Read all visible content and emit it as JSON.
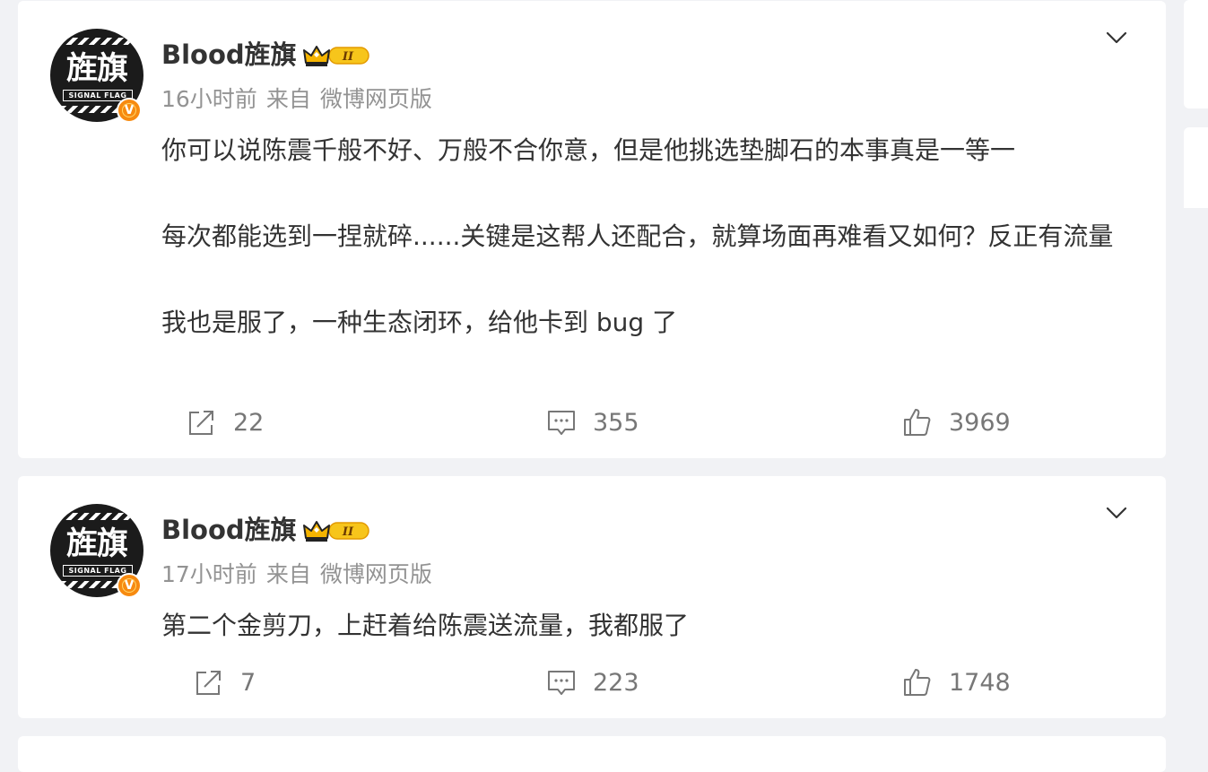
{
  "posts": [
    {
      "author": "Blood旌旗",
      "avatar_text": "旌旗",
      "avatar_subtext": "SIGNAL FLAG",
      "verified_mark": "V",
      "vip_level": "II",
      "time": "16小时前",
      "source_prefix": "来自",
      "source": "微博网页版",
      "paragraphs": [
        "你可以说陈震千般不好、万般不合你意，但是他挑选垫脚石的本事真是一等一",
        "每次都能选到一捏就碎......关键是这帮人还配合，就算场面再难看又如何？反正有流量",
        "我也是服了，一种生态闭环，给他卡到 bug 了"
      ],
      "reposts": "22",
      "comments": "355",
      "likes": "3969"
    },
    {
      "author": "Blood旌旗",
      "avatar_text": "旌旗",
      "avatar_subtext": "SIGNAL FLAG",
      "verified_mark": "V",
      "vip_level": "II",
      "time": "17小时前",
      "source_prefix": "来自",
      "source": "微博网页版",
      "paragraphs": [
        "第二个金剪刀，上赶着给陈震送流量，我都服了"
      ],
      "reposts": "7",
      "comments": "223",
      "likes": "1748"
    }
  ],
  "icons": {
    "more": "chevron-down-icon",
    "repost": "share-icon",
    "comment": "comment-icon",
    "like": "thumbs-up-icon",
    "vip": "crown-icon"
  },
  "colors": {
    "background": "#f1f2f5",
    "card": "#ffffff",
    "text": "#333333",
    "meta": "#939393",
    "verified": "#f78a10",
    "vip_gold": "#f5b400"
  }
}
